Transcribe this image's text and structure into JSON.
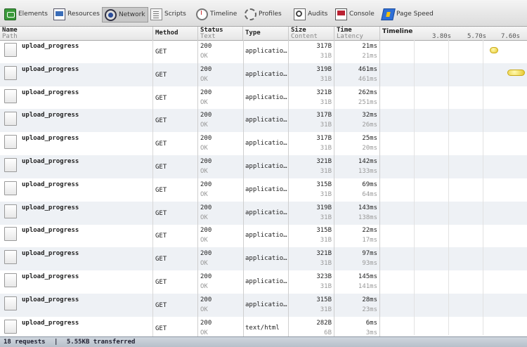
{
  "toolbar": {
    "items": [
      {
        "label": "Elements",
        "icon": "elements-icon"
      },
      {
        "label": "Resources",
        "icon": "resources-icon"
      },
      {
        "label": "Network",
        "icon": "network-icon",
        "active": true
      },
      {
        "label": "Scripts",
        "icon": "scripts-icon"
      },
      {
        "label": "Timeline",
        "icon": "timeline-icon"
      },
      {
        "label": "Profiles",
        "icon": "profiles-icon"
      },
      {
        "label": "Audits",
        "icon": "audits-icon"
      },
      {
        "label": "Console",
        "icon": "console-icon"
      },
      {
        "label": "Page Speed",
        "icon": "pagespeed-icon"
      }
    ]
  },
  "columns": {
    "name": {
      "main": "Name",
      "sub": "Path"
    },
    "method": {
      "main": "Method",
      "sub": ""
    },
    "status": {
      "main": "Status",
      "sub": "Text"
    },
    "type": {
      "main": "Type",
      "sub": ""
    },
    "size": {
      "main": "Size",
      "sub": "Content"
    },
    "time": {
      "main": "Time",
      "sub": "Latency"
    },
    "timeline": {
      "main": "Timeline",
      "sub": ""
    }
  },
  "timeline_ticks": [
    "3.80s",
    "5.70s",
    "7.60s"
  ],
  "rows": [
    {
      "name": "upload_progress",
      "method": "GET",
      "status": "200",
      "status_text": "OK",
      "type": "applicatio…",
      "size": "317B",
      "content": "31B",
      "time": "21ms",
      "latency": "21ms"
    },
    {
      "name": "upload_progress",
      "method": "GET",
      "status": "200",
      "status_text": "OK",
      "type": "applicatio…",
      "size": "319B",
      "content": "31B",
      "time": "461ms",
      "latency": "461ms"
    },
    {
      "name": "upload_progress",
      "method": "GET",
      "status": "200",
      "status_text": "OK",
      "type": "applicatio…",
      "size": "321B",
      "content": "31B",
      "time": "262ms",
      "latency": "251ms"
    },
    {
      "name": "upload_progress",
      "method": "GET",
      "status": "200",
      "status_text": "OK",
      "type": "applicatio…",
      "size": "317B",
      "content": "31B",
      "time": "32ms",
      "latency": "26ms"
    },
    {
      "name": "upload_progress",
      "method": "GET",
      "status": "200",
      "status_text": "OK",
      "type": "applicatio…",
      "size": "317B",
      "content": "31B",
      "time": "25ms",
      "latency": "20ms"
    },
    {
      "name": "upload_progress",
      "method": "GET",
      "status": "200",
      "status_text": "OK",
      "type": "applicatio…",
      "size": "321B",
      "content": "31B",
      "time": "142ms",
      "latency": "133ms"
    },
    {
      "name": "upload_progress",
      "method": "GET",
      "status": "200",
      "status_text": "OK",
      "type": "applicatio…",
      "size": "315B",
      "content": "31B",
      "time": "69ms",
      "latency": "64ms"
    },
    {
      "name": "upload_progress",
      "method": "GET",
      "status": "200",
      "status_text": "OK",
      "type": "applicatio…",
      "size": "319B",
      "content": "31B",
      "time": "143ms",
      "latency": "138ms"
    },
    {
      "name": "upload_progress",
      "method": "GET",
      "status": "200",
      "status_text": "OK",
      "type": "applicatio…",
      "size": "315B",
      "content": "31B",
      "time": "22ms",
      "latency": "17ms"
    },
    {
      "name": "upload_progress",
      "method": "GET",
      "status": "200",
      "status_text": "OK",
      "type": "applicatio…",
      "size": "321B",
      "content": "31B",
      "time": "97ms",
      "latency": "93ms"
    },
    {
      "name": "upload_progress",
      "method": "GET",
      "status": "200",
      "status_text": "OK",
      "type": "applicatio…",
      "size": "323B",
      "content": "31B",
      "time": "145ms",
      "latency": "141ms"
    },
    {
      "name": "upload_progress",
      "method": "GET",
      "status": "200",
      "status_text": "OK",
      "type": "applicatio…",
      "size": "315B",
      "content": "31B",
      "time": "28ms",
      "latency": "23ms"
    },
    {
      "name": "upload_progress",
      "method": "GET",
      "status": "200",
      "status_text": "OK",
      "type": "text/html",
      "size": "282B",
      "content": "6B",
      "time": "6ms",
      "latency": "3ms"
    }
  ],
  "statusbar": {
    "requests": "18 requests",
    "separator": "|",
    "transferred": "5.55KB transferred"
  }
}
